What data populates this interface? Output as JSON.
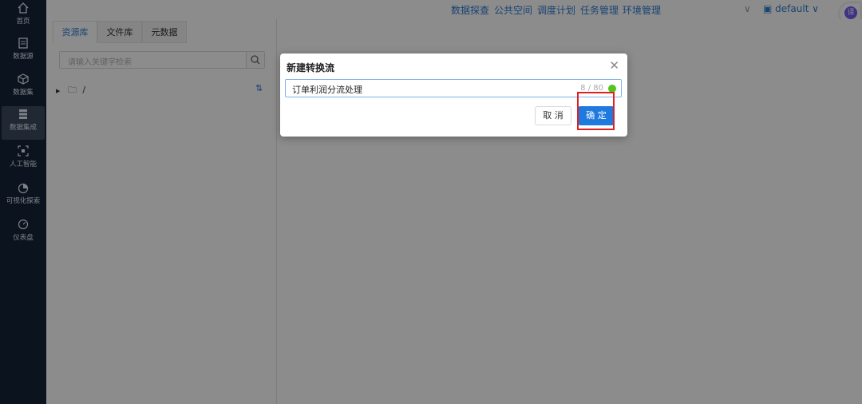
{
  "sidebar": {
    "items": [
      {
        "label": "首页",
        "icon": "home-icon"
      },
      {
        "label": "数据源",
        "icon": "file-icon"
      },
      {
        "label": "数据集",
        "icon": "cube-icon"
      },
      {
        "label": "数据集成",
        "icon": "database-icon",
        "active": true
      },
      {
        "label": "人工智能",
        "icon": "scan-icon"
      },
      {
        "label": "可视化探索",
        "icon": "pie-chart-icon"
      },
      {
        "label": "仪表盘",
        "icon": "gauge-icon"
      }
    ]
  },
  "topbar": {
    "links": [
      "数据探查",
      "公共空间",
      "调度计划",
      "任务管理",
      "环境管理"
    ],
    "workspace": "default",
    "translate_label": "译"
  },
  "panel": {
    "tabs": [
      "资源库",
      "文件库",
      "元数据"
    ],
    "search_placeholder": "请输入关键字检索",
    "tree_root": "/"
  },
  "dialog": {
    "title": "新建转换流",
    "input_value": "订单利润分流处理",
    "char_count": "8 / 80",
    "cancel_label": "取 消",
    "confirm_label": "确 定"
  },
  "colors": {
    "sidebar_bg": "#14243a",
    "accent": "#2f7ad0",
    "primary_button": "#1f7ae0",
    "highlight": "#e02020"
  }
}
